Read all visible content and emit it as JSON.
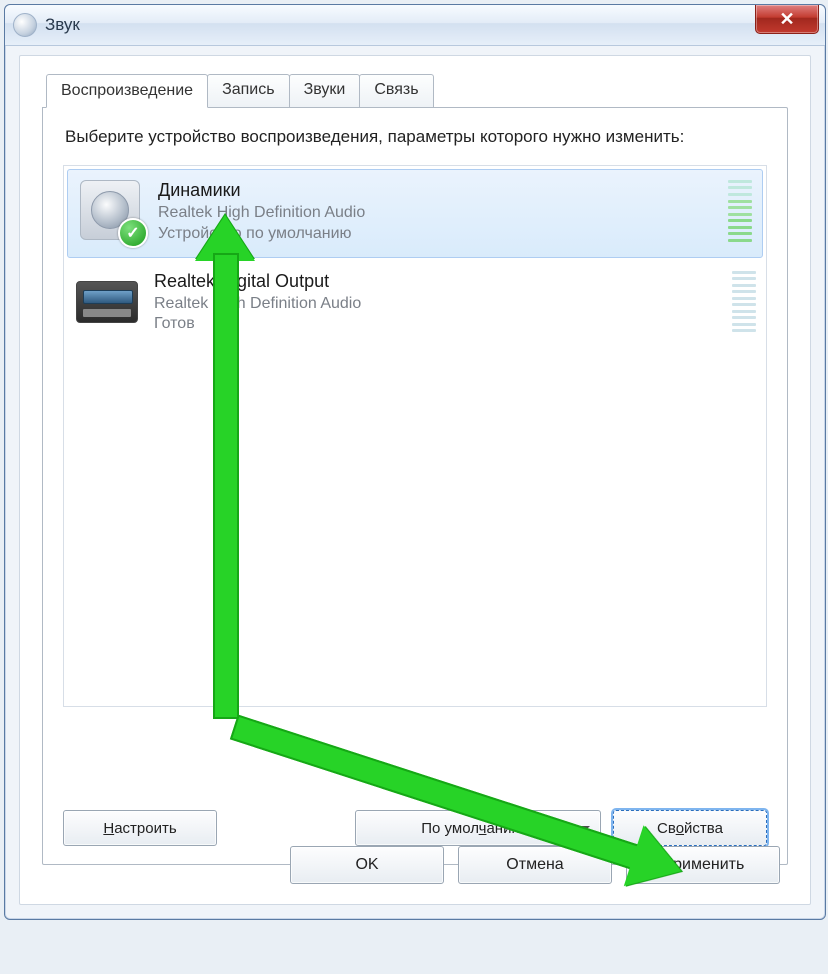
{
  "window": {
    "title": "Звук"
  },
  "tabs": {
    "playback": "Воспроизведение",
    "record": "Запись",
    "sounds": "Звуки",
    "comm": "Связь"
  },
  "instruction": "Выберите устройство воспроизведения, параметры которого нужно изменить:",
  "devices": [
    {
      "name": "Динамики",
      "driver": "Realtek High Definition Audio",
      "status": "Устройство по умолчанию",
      "default": true,
      "selected": true,
      "level": "active"
    },
    {
      "name": "Realtek Digital Output",
      "driver": "Realtek High Definition Audio",
      "status": "Готов",
      "default": false,
      "selected": false,
      "level": "idle"
    }
  ],
  "buttons": {
    "configure": "Настроить",
    "setdefault": "По умолчанию",
    "properties": "Свойства",
    "ok": "OK",
    "cancel": "Отмена",
    "apply": "Применить"
  },
  "accesskeys": {
    "configure_u": "Н",
    "setdefault_u": "ч",
    "properties_u": "о",
    "apply_u": "П"
  }
}
